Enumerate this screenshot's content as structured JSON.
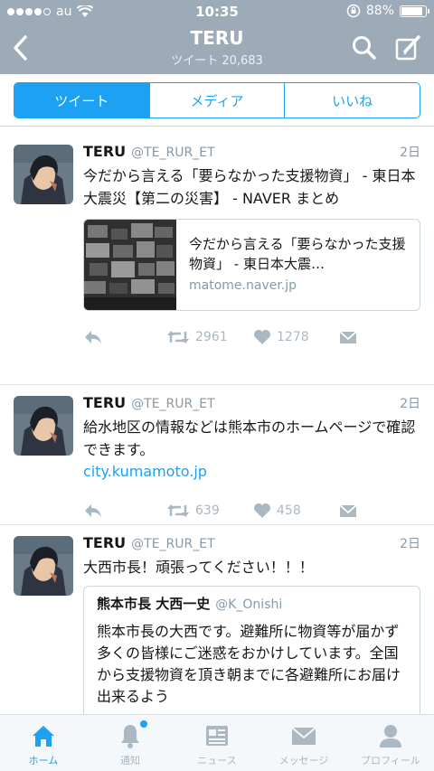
{
  "status": {
    "carrier": "au",
    "time": "10:35",
    "battery": "88%",
    "battery_level": 0.88
  },
  "nav": {
    "title": "TERU",
    "subtitle": "ツイート 20,683"
  },
  "segments": [
    {
      "label": "ツイート"
    },
    {
      "label": "メディア"
    },
    {
      "label": "いいね"
    }
  ],
  "tweets": [
    {
      "name": "TERU",
      "handle": "@TE_RUR_ET",
      "time": "2日",
      "text": "今だから言える「要らなかった支援物資」 - 東日本大震災【第二の災害】 - NAVER まとめ",
      "card": {
        "title": "今だから言える「要らなかった支援物資」 - 東日本大震…",
        "domain": "matome.naver.jp"
      },
      "retweets": "2961",
      "likes": "1278"
    },
    {
      "name": "TERU",
      "handle": "@TE_RUR_ET",
      "time": "2日",
      "text": "給水地区の情報などは熊本市のホームページで確認できます。",
      "link": "city.kumamoto.jp",
      "retweets": "639",
      "likes": "458"
    },
    {
      "name": "TERU",
      "handle": "@TE_RUR_ET",
      "time": "2日",
      "text": "大西市長！頑張ってください！！！",
      "quote": {
        "name": "熊本市長 大西一史",
        "handle": "@K_Onishi",
        "text": "熊本市長の大西です。避難所に物資等が届かず多くの皆様にご迷惑をおかけしています。全国から支援物資を頂き朝までに各避難所にお届け出来るよう"
      }
    }
  ],
  "tabbar": [
    {
      "label": "ホーム",
      "icon": "home-icon"
    },
    {
      "label": "通知",
      "icon": "bell-icon"
    },
    {
      "label": "ニュース",
      "icon": "news-icon"
    },
    {
      "label": "メッセージ",
      "icon": "envelope-icon"
    },
    {
      "label": "プロフィール",
      "icon": "profile-icon"
    }
  ],
  "colors": {
    "accent": "#1da1f2",
    "navbar": "#9daab8",
    "muted": "#8899a6"
  }
}
